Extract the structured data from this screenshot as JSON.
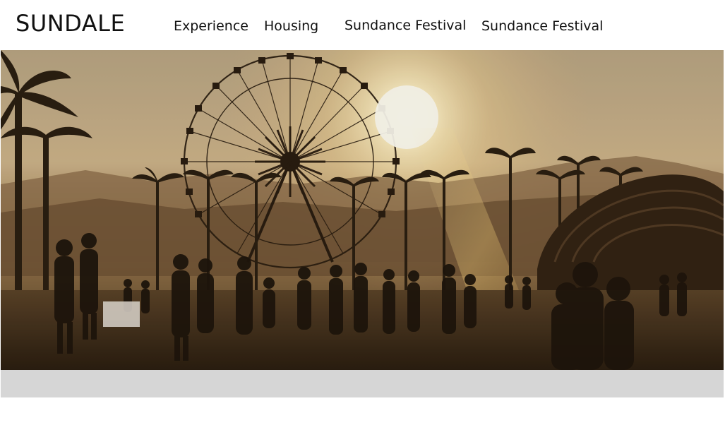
{
  "header": {
    "brand": "SUNDALE",
    "nav": [
      {
        "label": "Experience"
      },
      {
        "label": "Housing"
      },
      {
        "label": "Sundance Festival"
      },
      {
        "label": "Sundance Festival"
      }
    ]
  },
  "hero": {
    "image_subject": "festival crowd at sunset with ferris wheel and palm trees"
  },
  "colors": {
    "sky_top": "#c9b089",
    "sun": "#fff6d8",
    "ground": "#3a2a18",
    "strip": "#d6d6d6"
  }
}
